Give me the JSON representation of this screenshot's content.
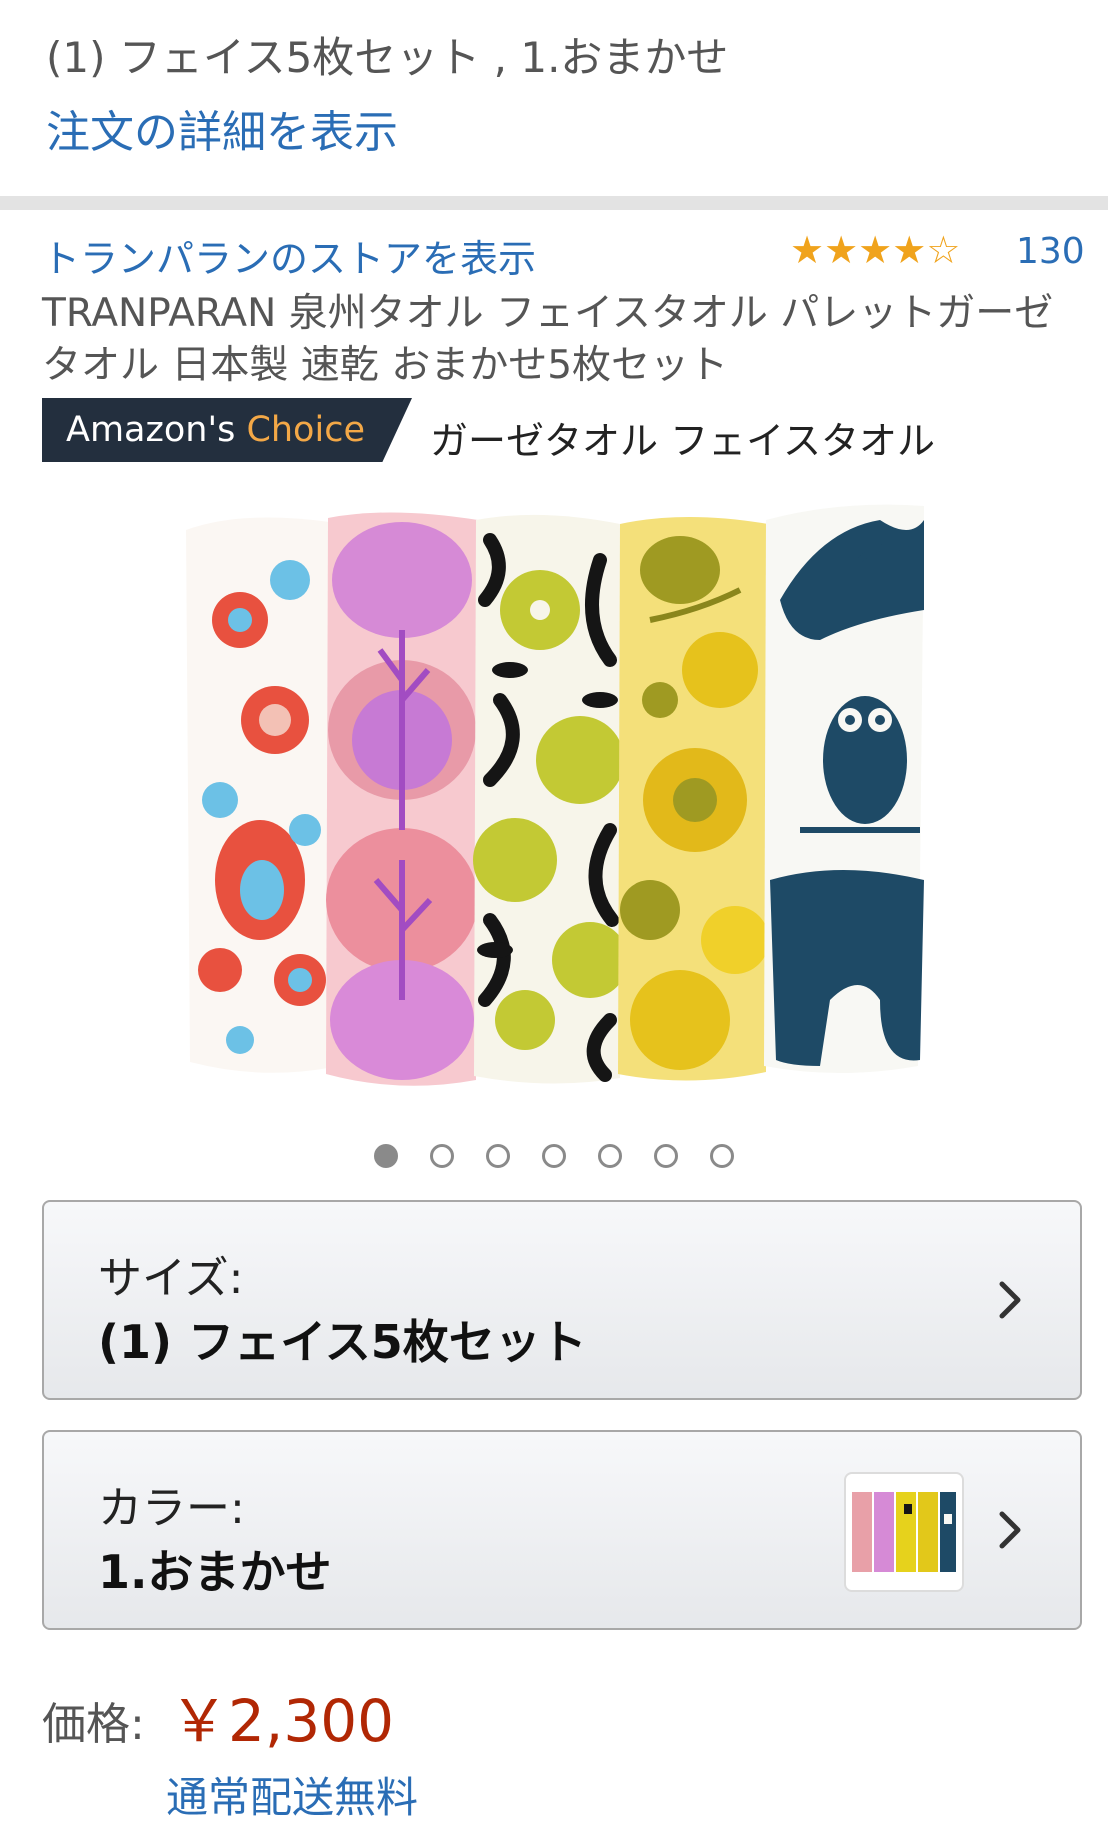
{
  "order": {
    "variant_summary": "(1) フェイス5枚セット , 1.おまかせ",
    "details_link": "注文の詳細を表示"
  },
  "product": {
    "store_link": "トランパランのストアを表示",
    "rating": 4,
    "rating_max": 5,
    "review_count": "130",
    "title_line1": "TRANPARAN 泉州タオル フェイスタオル パレットガーゼ",
    "title_line2": "タオル 日本製 速乾 おまかせ5枚セット",
    "badge_amazon": "Amazon's ",
    "badge_choice": "Choice",
    "badge_keyword": "ガーゼタオル フェイスタオル",
    "image_count": 7,
    "current_image": 1
  },
  "options": {
    "size_label": "サイズ:",
    "size_value": "(1) フェイス5枚セット",
    "color_label": "カラー:",
    "color_value": "1.おまかせ"
  },
  "pricing": {
    "price_label": "価格:",
    "price_value": "￥2,300",
    "shipping": "通常配送無料"
  },
  "colors": {
    "link": "#2a6db5",
    "price": "#b12704",
    "star": "#f0a31c",
    "badge_bg": "#232f3e",
    "badge_choice": "#f3a847"
  }
}
